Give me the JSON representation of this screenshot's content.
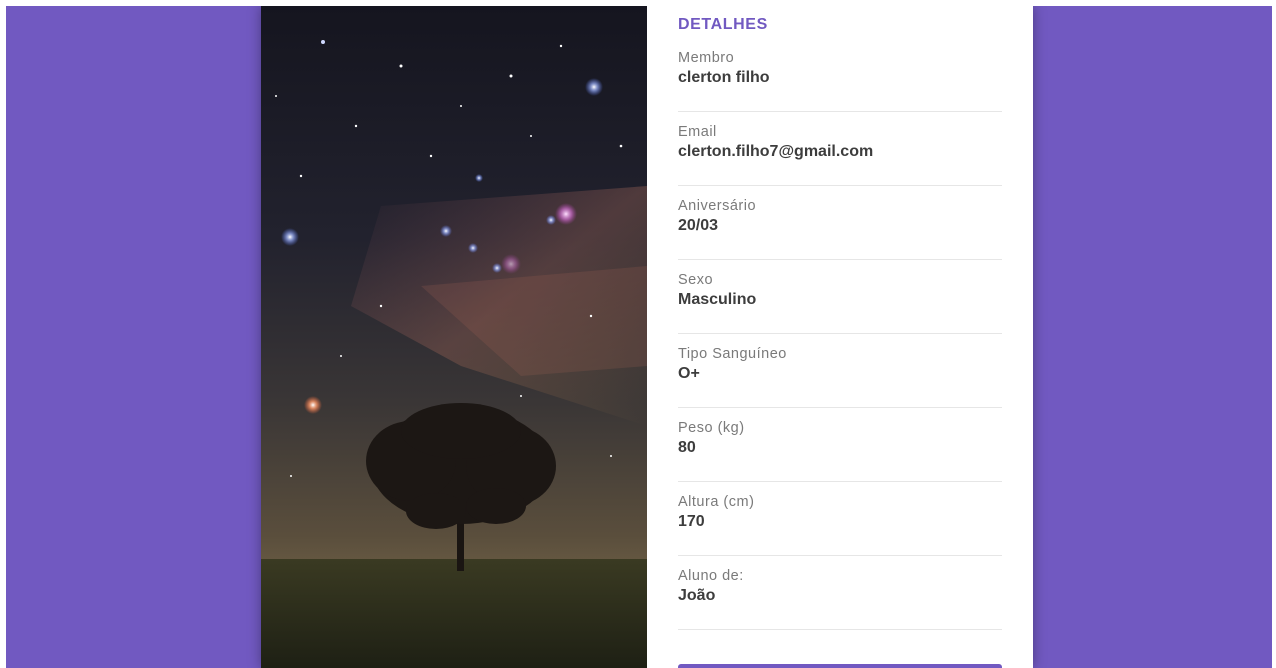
{
  "colors": {
    "background": "#7159c1",
    "accent": "#7159c1"
  },
  "details": {
    "title": "DETALHES",
    "fields": [
      {
        "label": "Membro",
        "value": "clerton filho"
      },
      {
        "label": "Email",
        "value": "clerton.filho7@gmail.com"
      },
      {
        "label": "Aniversário",
        "value": "20/03"
      },
      {
        "label": "Sexo",
        "value": "Masculino"
      },
      {
        "label": "Tipo Sanguíneo",
        "value": "O+"
      },
      {
        "label": "Peso (kg)",
        "value": "80"
      },
      {
        "label": "Altura (cm)",
        "value": "170"
      },
      {
        "label": "Aluno de:",
        "value": "João"
      }
    ]
  }
}
